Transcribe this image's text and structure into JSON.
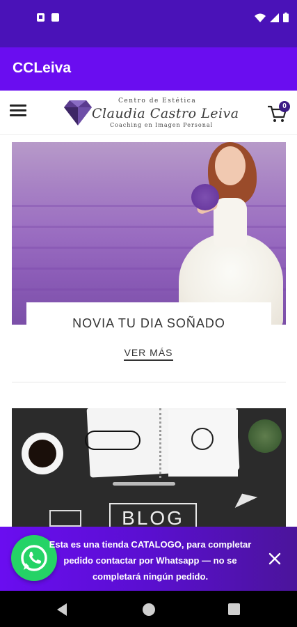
{
  "app": {
    "title": "CCLeiva"
  },
  "header": {
    "logo_top": "Centro de Estética",
    "logo_main": "Claudia Castro Leiva",
    "logo_sub": "Coaching en Imagen Personal",
    "cart_count": "0",
    "icons": {
      "menu": "hamburger-menu-icon",
      "cart": "shopping-cart-icon",
      "logo": "diamond-logo-icon"
    }
  },
  "hero": {
    "title": "NOVIA TU DIA SOÑADO",
    "link_label": "VER MÁS"
  },
  "blog": {
    "image_word": "BLOG"
  },
  "banner": {
    "text": "Esta es una tienda CATALOGO, para completar pedido contactar por Whatsapp — no se completará ningún pedido.",
    "icons": {
      "whatsapp": "whatsapp-icon",
      "close": "close-icon"
    }
  },
  "colors": {
    "status_bar": "#4a12b8",
    "app_bar": "#6a0df0",
    "banner_start": "#6a0df0",
    "banner_end": "#4b149b",
    "whatsapp": "#25d366",
    "cart_badge": "#3b1a84"
  }
}
